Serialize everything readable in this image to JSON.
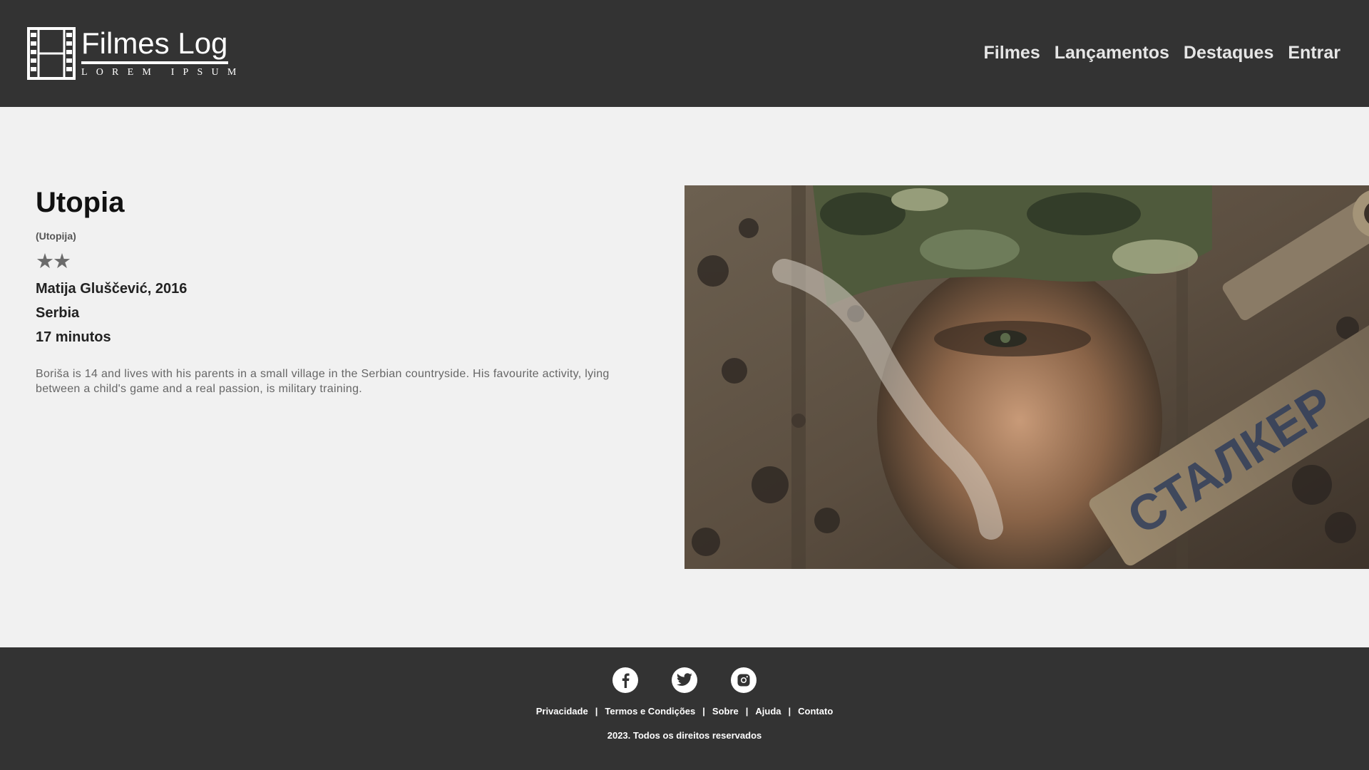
{
  "header": {
    "logo_title": "Filmes Log",
    "logo_subtitle": "Lorem Ipsum",
    "nav": [
      {
        "label": "Filmes"
      },
      {
        "label": "Lançamentos"
      },
      {
        "label": "Destaques"
      },
      {
        "label": "Entrar"
      }
    ]
  },
  "movie": {
    "title": "Utopia",
    "original_title": "(Utopija)",
    "rating_stars": 2,
    "rating_display": "★★",
    "director_year": "Matija Gluščević, 2016",
    "country": "Serbia",
    "duration": "17 minutos",
    "synopsis": "Boriša is 14 and lives with his parents in a small village in the Serbian countryside. His favourite activity, lying between a child's game and a real passion, is military training.",
    "still_text": "СТАЛКЕР"
  },
  "footer": {
    "social": [
      {
        "icon": "facebook-icon"
      },
      {
        "icon": "twitter-icon"
      },
      {
        "icon": "instagram-icon"
      }
    ],
    "links": [
      {
        "label": "Privacidade"
      },
      {
        "label": "Termos e Condições"
      },
      {
        "label": "Sobre"
      },
      {
        "label": "Ajuda"
      },
      {
        "label": "Contato"
      }
    ],
    "separator": "|",
    "copyright": "2023. Todos os direitos reservados"
  },
  "colors": {
    "header_bg": "#333333",
    "page_bg": "#f1f1f1",
    "footer_bg": "#333333"
  }
}
